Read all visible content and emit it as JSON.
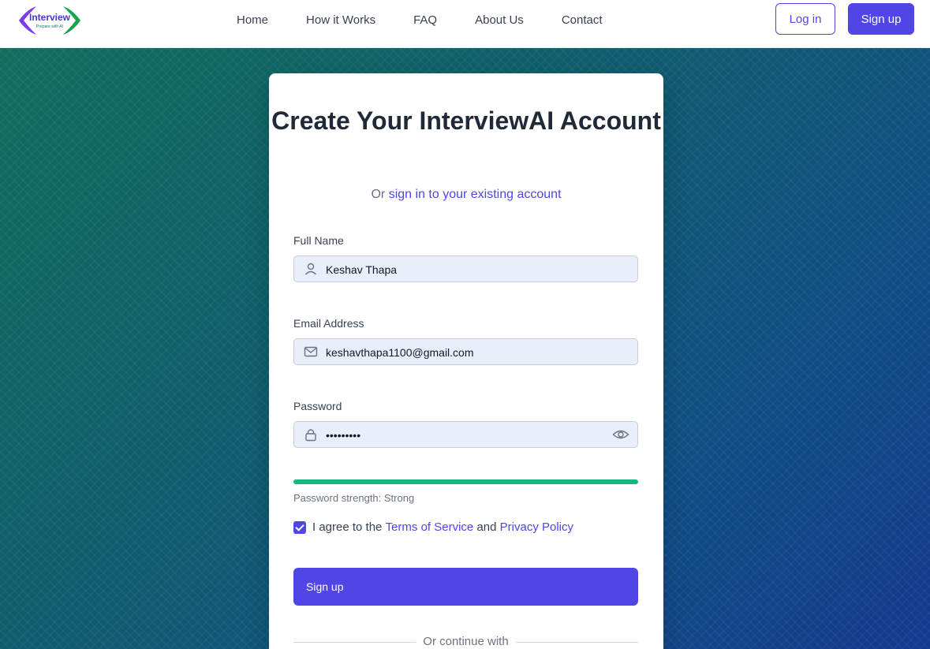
{
  "header": {
    "logo_text": "Interview",
    "logo_tagline": "Prepare with AI",
    "nav": [
      "Home",
      "How it Works",
      "FAQ",
      "About Us",
      "Contact"
    ],
    "login_label": "Log in",
    "signup_label": "Sign up"
  },
  "card": {
    "title": "Create Your InterviewAI Account",
    "subtitle_prefix": "Or",
    "subtitle_link": "sign in to your existing account",
    "fullname": {
      "label": "Full Name",
      "value": "Keshav Thapa",
      "icon": "user-icon"
    },
    "email": {
      "label": "Email Address",
      "value": "keshavthapa1100@gmail.com",
      "icon": "mail-icon"
    },
    "password": {
      "label": "Password",
      "value": "•••••••••",
      "icon": "lock-icon"
    },
    "strength": {
      "text": "Password strength: Strong",
      "level": 1.0,
      "color": "#10b981"
    },
    "agree": {
      "prefix": "I agree to the",
      "terms": "Terms of Service",
      "and": "and",
      "privacy": "Privacy Policy",
      "checked": true
    },
    "submit_label": "Sign up",
    "divider_text": "Or continue with"
  },
  "colors": {
    "accent": "#4f46e5",
    "success": "#10b981"
  }
}
